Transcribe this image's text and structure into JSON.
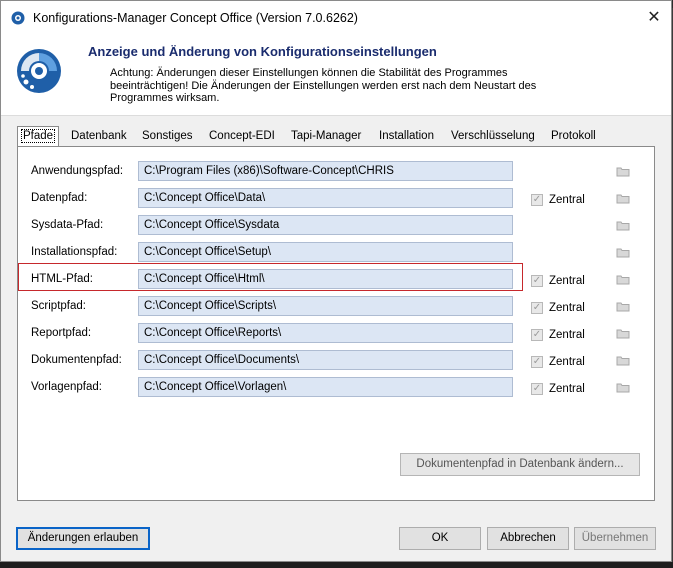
{
  "window": {
    "title": "Konfigurations-Manager Concept Office (Version 7.0.6262)",
    "close_glyph": "✕"
  },
  "header": {
    "title": "Anzeige und Änderung von Konfigurationseinstellungen",
    "description": "Achtung: Änderungen dieser Einstellungen können die Stabilität des Programmes beeinträchtigen! Die Änderungen der Einstellungen werden erst nach dem Neustart des Programmes wirksam."
  },
  "tabs": [
    {
      "label": "Pfade",
      "active": true
    },
    {
      "label": "Datenbank"
    },
    {
      "label": "Sonstiges"
    },
    {
      "label": "Concept-EDI"
    },
    {
      "label": "Tapi-Manager"
    },
    {
      "label": "Installation"
    },
    {
      "label": "Verschlüsselung"
    },
    {
      "label": "Protokoll"
    }
  ],
  "paths": [
    {
      "label": "Anwendungspfad:",
      "value": "C:\\Program Files (x86)\\Software-Concept\\CHRIS",
      "zentral": null
    },
    {
      "label": "Datenpfad:",
      "value": "C:\\Concept Office\\Data\\",
      "zentral": "Zentral"
    },
    {
      "label": "Sysdata-Pfad:",
      "value": "C:\\Concept Office\\Sysdata",
      "zentral": null
    },
    {
      "label": "Installationspfad:",
      "value": "C:\\Concept Office\\Setup\\",
      "zentral": null
    },
    {
      "label": "HTML-Pfad:",
      "value": "C:\\Concept Office\\Html\\",
      "zentral": "Zentral"
    },
    {
      "label": "Scriptpfad:",
      "value": "C:\\Concept Office\\Scripts\\",
      "zentral": "Zentral"
    },
    {
      "label": "Reportpfad:",
      "value": "C:\\Concept Office\\Reports\\",
      "zentral": "Zentral"
    },
    {
      "label": "Dokumentenpfad:",
      "value": "C:\\Concept Office\\Documents\\",
      "zentral": "Zentral"
    },
    {
      "label": "Vorlagenpfad:",
      "value": "C:\\Concept Office\\Vorlagen\\",
      "zentral": "Zentral"
    }
  ],
  "buttons": {
    "doc_db": "Dokumentenpfad in Datenbank ändern...",
    "allow": "Änderungen erlauben",
    "ok": "OK",
    "cancel": "Abbrechen",
    "apply": "Übernehmen"
  },
  "colors": {
    "header_title": "#1a2c6e",
    "field_bg": "#dce6f4",
    "highlight": "#c6282c",
    "default_button_border": "#0a64c8"
  }
}
